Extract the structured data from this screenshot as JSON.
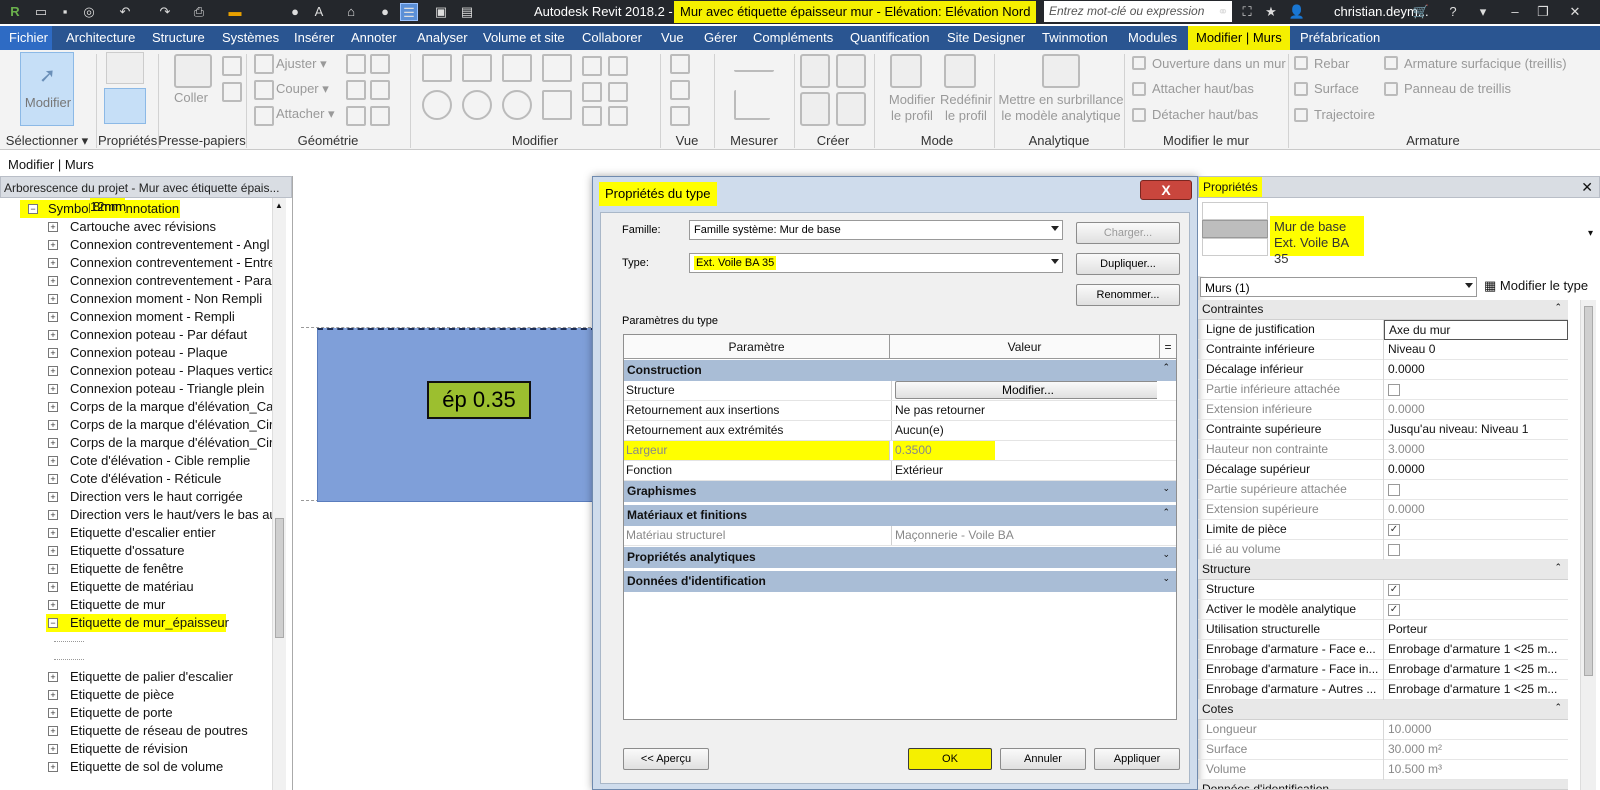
{
  "titlebar": {
    "app_title": "Autodesk Revit 2018.2 -",
    "doc_title": "Mur avec étiquette épaisseur mur - Elévation: Elévation Nord",
    "search_placeholder": "Entrez mot-clé ou expression",
    "user": "christian.deym..."
  },
  "menu": [
    "Fichier",
    "Architecture",
    "Structure",
    "Systèmes",
    "Insérer",
    "Annoter",
    "Analyser",
    "Volume et site",
    "Collaborer",
    "Vue",
    "Gérer",
    "Compléments",
    "Quantification",
    "Site Designer",
    "Twinmotion",
    "Modules",
    "Modifier | Murs",
    "Préfabrication"
  ],
  "ribbon": {
    "modify_btn": "Modifier",
    "select_label": "Sélectionner ▾",
    "groups": [
      "Propriétés",
      "Presse-papiers",
      "Géométrie",
      "Modifier",
      "Vue",
      "Mesurer",
      "Créer",
      "Mode",
      "Analytique",
      "Modifier le mur",
      "Armature"
    ],
    "coller": "Coller",
    "geometry_items": [
      "Ajuster ▾",
      "Couper ▾",
      "Attacher ▾"
    ],
    "mode_items": [
      "Modifier le profil",
      "Redéfinir le profil"
    ],
    "analytique_item": "Mettre en surbrillance le modèle analytique",
    "wall_items": [
      "Ouverture dans un mur",
      "Attacher haut/bas",
      "Détacher haut/bas"
    ],
    "armature_items": [
      "Rebar",
      "Surface",
      "Trajectoire",
      "Armature  surfacique (treillis)",
      "Panneau  de treillis"
    ]
  },
  "context_label": "Modifier | Murs",
  "project_browser": {
    "title": "Arborescence du projet - Mur avec étiquette épais...",
    "root": "Symboles d'annotation",
    "items": [
      "Cartouche avec révisions",
      "Connexion contreventement - Angl",
      "Connexion contreventement - Entre",
      "Connexion contreventement - Paral",
      "Connexion moment - Non Rempli",
      "Connexion moment - Rempli",
      "Connexion poteau - Par défaut",
      "Connexion poteau - Plaque",
      "Connexion poteau - Plaques vertica",
      "Connexion poteau - Triangle plein",
      "Corps de la marque d'élévation_Carr",
      "Corps de la marque d'élévation_Circ",
      "Corps de la marque d'élévation_Circ",
      "Cote d'élévation - Cible remplie",
      "Cote d'élévation - Réticule",
      "Direction vers le haut corrigée",
      "Direction vers le haut/vers le bas au",
      "Etiquette d'escalier entier",
      "Etiquette d'ossature",
      "Etiquette de fenêtre",
      "Etiquette de matériau",
      "Etiquette de mur"
    ],
    "expanded": "Etiquette de mur_épaisseur",
    "children": [
      "8mm",
      "12mm"
    ],
    "items_after": [
      "Etiquette de palier d'escalier",
      "Etiquette de pièce",
      "Etiquette de porte",
      "Etiquette de réseau de poutres",
      "Etiquette de révision",
      "Etiquette de sol de volume"
    ]
  },
  "view": {
    "tag_text": "ép 0.35"
  },
  "dialog": {
    "title": "Propriétés du type",
    "close": "X",
    "famille_label": "Famille:",
    "famille_value": "Famille système: Mur de base",
    "type_label": "Type:",
    "type_value": "Ext. Voile BA 35",
    "btn_charger": "Charger...",
    "btn_dupliquer": "Dupliquer...",
    "btn_renommer": "Renommer...",
    "params_label": "Paramètres du type",
    "col_param": "Paramètre",
    "col_value": "Valeur",
    "col_eq": "=",
    "groups": {
      "construction": "Construction",
      "graphismes": "Graphismes",
      "materiaux": "Matériaux et finitions",
      "analytiques": "Propriétés analytiques",
      "identification": "Données d'identification"
    },
    "rows": {
      "structure": {
        "name": "Structure",
        "value": "Modifier..."
      },
      "ret_ins": {
        "name": "Retournement aux insertions",
        "value": "Ne pas retourner"
      },
      "ret_ext": {
        "name": "Retournement aux extrémités",
        "value": "Aucun(e)"
      },
      "largeur": {
        "name": "Largeur",
        "value": "0.3500"
      },
      "fonction": {
        "name": "Fonction",
        "value": "Extérieur"
      },
      "materiau": {
        "name": "Matériau structurel",
        "value": "Maçonnerie - Voile BA"
      }
    },
    "btn_apercu": "<< Aperçu",
    "btn_ok": "OK",
    "btn_annuler": "Annuler",
    "btn_appliquer": "Appliquer"
  },
  "properties": {
    "title": "Propriétés",
    "type_name1": "Mur de base",
    "type_name2": "Ext. Voile BA 35",
    "selector": "Murs (1)",
    "edit_type": "Modifier le type",
    "cat_contraintes": "Contraintes",
    "rows_contraintes": [
      {
        "k": "Ligne de justification",
        "v": "Axe du mur",
        "dim": false
      },
      {
        "k": "Contrainte inférieure",
        "v": "Niveau 0",
        "dim": false
      },
      {
        "k": "Décalage inférieur",
        "v": "0.0000",
        "dim": false
      },
      {
        "k": "Partie inférieure attachée",
        "v": "",
        "dim": true,
        "check": "off"
      },
      {
        "k": "Extension inférieure",
        "v": "0.0000",
        "dim": true
      },
      {
        "k": "Contrainte supérieure",
        "v": "Jusqu'au niveau: Niveau 1",
        "dim": false
      },
      {
        "k": "Hauteur non contrainte",
        "v": "3.0000",
        "dim": true
      },
      {
        "k": "Décalage supérieur",
        "v": "0.0000",
        "dim": false
      },
      {
        "k": "Partie supérieure attachée",
        "v": "",
        "dim": true,
        "check": "off"
      },
      {
        "k": "Extension supérieure",
        "v": "0.0000",
        "dim": true
      },
      {
        "k": "Limite de pièce",
        "v": "",
        "dim": false,
        "check": "on"
      },
      {
        "k": "Lié au volume",
        "v": "",
        "dim": true,
        "check": "off"
      }
    ],
    "cat_structure": "Structure",
    "rows_structure": [
      {
        "k": "Structure",
        "v": "",
        "dim": false,
        "check": "on"
      },
      {
        "k": "Activer le modèle analytique",
        "v": "",
        "dim": false,
        "check": "on"
      },
      {
        "k": "Utilisation structurelle",
        "v": "Porteur",
        "dim": false
      },
      {
        "k": "Enrobage d'armature - Face e...",
        "v": "Enrobage d'armature 1 <25 m...",
        "dim": false
      },
      {
        "k": "Enrobage d'armature - Face in...",
        "v": "Enrobage d'armature 1 <25 m...",
        "dim": false
      },
      {
        "k": "Enrobage d'armature - Autres ...",
        "v": "Enrobage d'armature 1 <25 m...",
        "dim": false
      }
    ],
    "cat_cotes": "Cotes",
    "rows_cotes": [
      {
        "k": "Longueur",
        "v": "10.0000",
        "dim": true
      },
      {
        "k": "Surface",
        "v": "30.000 m²",
        "dim": true
      },
      {
        "k": "Volume",
        "v": "10.500 m³",
        "dim": true
      }
    ],
    "cat_ident": "Données d'identification"
  }
}
